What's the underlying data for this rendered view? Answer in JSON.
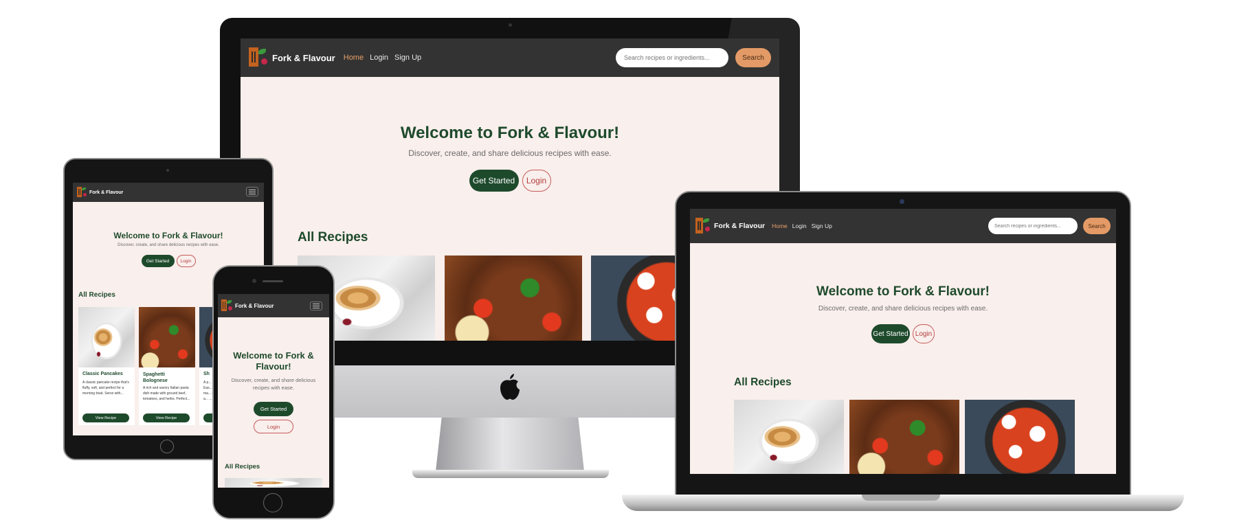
{
  "brand": {
    "name": "Fork & Flavour"
  },
  "nav": {
    "home": "Home",
    "login": "Login",
    "signup": "Sign Up"
  },
  "search": {
    "placeholder": "Search recipes or ingredients...",
    "button": "Search"
  },
  "hero": {
    "title": "Welcome to Fork & Flavour!",
    "subtitle": "Discover, create, and share delicious recipes with ease.",
    "get_started": "Get Started",
    "login": "Login"
  },
  "recipes": {
    "section_title": "All Recipes",
    "items": [
      {
        "title": "Classic Pancakes",
        "description": "A classic pancake recipe that's fluffy, soft, and perfect for a morning treat. Serve with...",
        "button": "View Recipe"
      },
      {
        "title": "Spaghetti Bolognese",
        "description": "A rich and savory Italian pasta dish made with ground beef, tomatoes, and herbs. Perfect...",
        "button": "View Recipe"
      },
      {
        "title": "Sh",
        "description": "A p... Eas... ma... in a... ...",
        "button": ""
      }
    ]
  },
  "colors": {
    "nav_bg": "#333333",
    "page_bg": "#f9efec",
    "primary_green": "#1e4a2c",
    "accent_orange": "#e39a66",
    "login_red": "#b23c3c"
  },
  "icons": {
    "menu": "hamburger-menu-icon",
    "apple": "apple-logo-icon"
  }
}
